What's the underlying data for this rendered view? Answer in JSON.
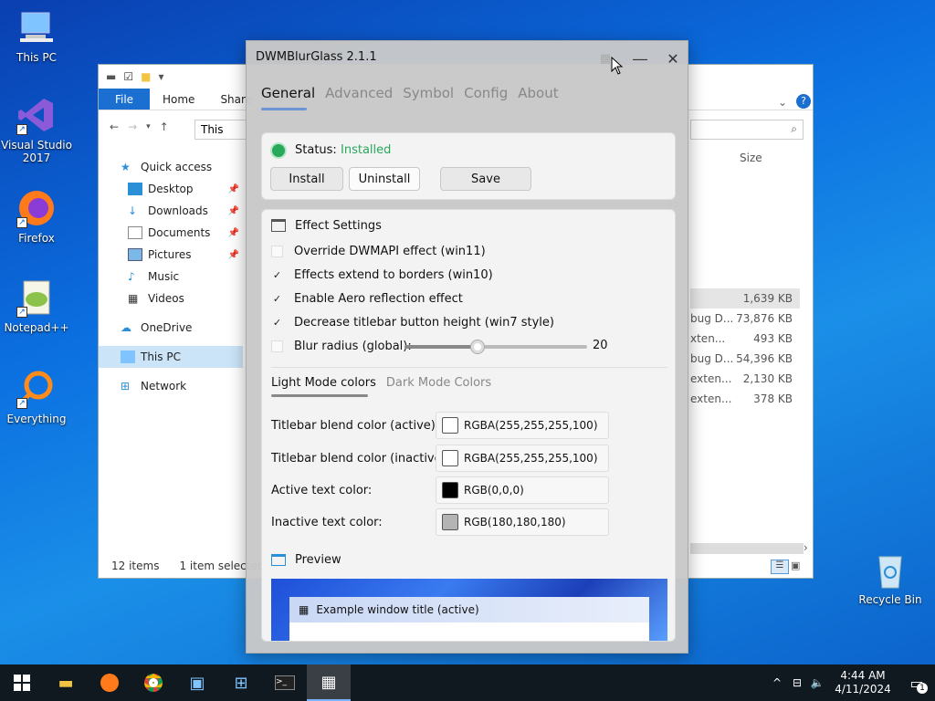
{
  "desktop": {
    "icons": [
      {
        "label": "This PC"
      },
      {
        "label": "Visual Studio 2017"
      },
      {
        "label": "Firefox"
      },
      {
        "label": "Notepad++"
      },
      {
        "label": "Everything"
      },
      {
        "label": "Recycle Bin"
      }
    ]
  },
  "explorer": {
    "ribbon": {
      "file": "File",
      "home": "Home",
      "share": "Share"
    },
    "address": "This",
    "sidebar": [
      {
        "label": "Quick access"
      },
      {
        "label": "Desktop"
      },
      {
        "label": "Downloads"
      },
      {
        "label": "Documents"
      },
      {
        "label": "Pictures"
      },
      {
        "label": "Music"
      },
      {
        "label": "Videos"
      },
      {
        "label": "OneDrive"
      },
      {
        "label": "This PC"
      },
      {
        "label": "Network"
      }
    ],
    "size_header": "Size",
    "rows": [
      {
        "type": "",
        "size": "1,639 KB"
      },
      {
        "type": "bug D...",
        "size": "73,876 KB"
      },
      {
        "type": "xten...",
        "size": "493 KB"
      },
      {
        "type": "bug D...",
        "size": "54,396 KB"
      },
      {
        "type": "exten...",
        "size": "2,130 KB"
      },
      {
        "type": "exten...",
        "size": "378 KB"
      }
    ],
    "status": {
      "items": "12 items",
      "selected": "1 item selected"
    }
  },
  "app": {
    "title": "DWMBlurGlass 2.1.1",
    "tabs": [
      "General",
      "Advanced",
      "Symbol",
      "Config",
      "About"
    ],
    "status_label": "Status:",
    "status_value": "Installed",
    "status_color": "#27a85a",
    "buttons": {
      "install": "Install",
      "uninstall": "Uninstall",
      "save": "Save"
    },
    "effect_settings": {
      "header": "Effect Settings",
      "options": [
        {
          "label": "Override DWMAPI effect (win11)",
          "checked": false
        },
        {
          "label": "Effects extend to borders (win10)",
          "checked": true
        },
        {
          "label": "Enable Aero reflection effect",
          "checked": true
        },
        {
          "label": "Decrease titlebar button height (win7 style)",
          "checked": true
        }
      ],
      "blur": {
        "label": "Blur radius (global):",
        "checked": false,
        "value": "20",
        "fraction": 0.4
      }
    },
    "color_tabs": [
      "Light Mode colors",
      "Dark Mode Colors"
    ],
    "colors": [
      {
        "label": "Titlebar blend color (active):",
        "value": "RGBA(255,255,255,100)",
        "swatch": "#ffffff"
      },
      {
        "label": "Titlebar blend color (inactive):",
        "value": "RGBA(255,255,255,100)",
        "swatch": "#ffffff"
      },
      {
        "label": "Active text color:",
        "value": "RGB(0,0,0)",
        "swatch": "#000000"
      },
      {
        "label": "Inactive text color:",
        "value": "RGB(180,180,180)",
        "swatch": "#b4b4b4"
      }
    ],
    "preview": {
      "header": "Preview",
      "window_title": "Example window title (active)"
    }
  },
  "taskbar": {
    "time": "4:44 AM",
    "date": "4/11/2024",
    "notification_count": "1"
  }
}
